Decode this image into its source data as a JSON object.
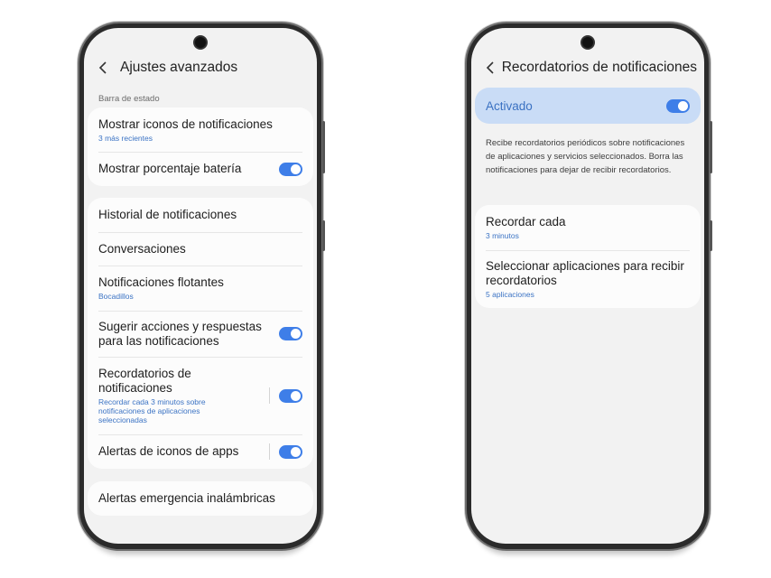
{
  "left_screen": {
    "title": "Ajustes avanzados",
    "section_label": "Barra de estado",
    "group1": [
      {
        "title": "Mostrar iconos de notificaciones",
        "subtitle": "3 más recientes"
      },
      {
        "title": "Mostrar porcentaje batería",
        "toggle": "on"
      }
    ],
    "group2": [
      {
        "title": "Historial de notificaciones"
      },
      {
        "title": "Conversaciones"
      },
      {
        "title": "Notificaciones flotantes",
        "subtitle": "Bocadillos"
      },
      {
        "title": "Sugerir acciones y respuestas para las notificaciones",
        "toggle": "on"
      },
      {
        "title": "Recordatorios de notificaciones",
        "subtitle": "Recordar cada 3 minutos sobre notificaciones de aplicaciones seleccionadas",
        "toggle": "on"
      },
      {
        "title": "Alertas de iconos de apps",
        "toggle": "on"
      }
    ],
    "group3": [
      {
        "title": "Alertas emergencia inalámbricas"
      }
    ]
  },
  "right_screen": {
    "title": "Recordatorios de notificaciones",
    "activated_label": "Activado",
    "activated_toggle": "on",
    "description": "Recibe recordatorios periódicos sobre notificaciones de aplicaciones y servicios seleccionados. Borra las notificaciones para dejar de recibir recordatorios.",
    "items": [
      {
        "title": "Recordar cada",
        "subtitle": "3 minutos"
      },
      {
        "title": "Seleccionar aplicaciones para recibir recordatorios",
        "subtitle": "5 aplicaciones"
      }
    ]
  },
  "colors": {
    "accent": "#3e7ee8",
    "link": "#3b73c4",
    "activated_bg": "#c9dcf6",
    "screen_bg": "#f2f2f2"
  },
  "icons": [
    "back-chevron-icon",
    "camera-icon",
    "toggle-switch-icon"
  ]
}
